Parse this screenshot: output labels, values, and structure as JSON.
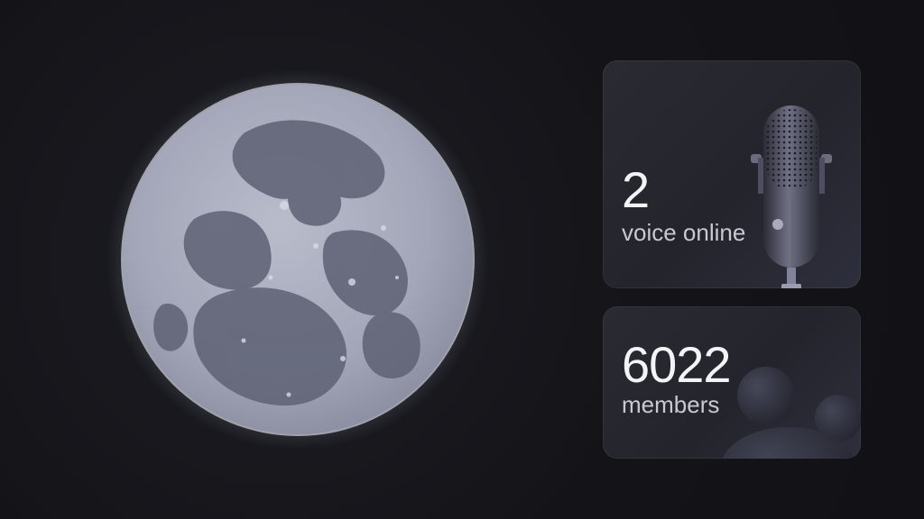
{
  "stats": {
    "voice": {
      "count": "2",
      "label": "voice online",
      "icon": "microphone-icon"
    },
    "members": {
      "count": "6022",
      "label": "members",
      "icon": "members-blob-icon"
    }
  },
  "colors": {
    "background": "#141418",
    "card": "#2a2a33",
    "text_primary": "#f4f4f8",
    "text_secondary": "#c9c9d2",
    "moon": "#aeb1c1"
  }
}
